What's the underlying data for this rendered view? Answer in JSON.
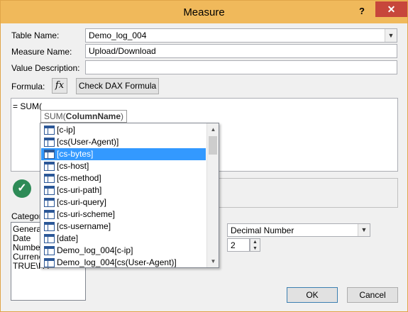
{
  "window": {
    "title": "Measure",
    "help": "?",
    "close": "✕"
  },
  "labels": {
    "table_name": "Table Name:",
    "measure_name": "Measure Name:",
    "value_description": "Value Description:",
    "formula": "Formula:",
    "category": "Categor"
  },
  "fields": {
    "table_name_value": "Demo_log_004",
    "measure_name_value": "Upload/Download",
    "value_description_value": ""
  },
  "formula": {
    "fx_label": "fx",
    "check_dax_button": "Check DAX Formula",
    "text": "= SUM(",
    "tooltip_prefix": "SUM(",
    "tooltip_param": "ColumnName",
    "tooltip_suffix": ")"
  },
  "autocomplete": {
    "selected_index": 2,
    "items": [
      "[c-ip]",
      "[cs(User-Agent)]",
      "[cs-bytes]",
      "[cs-host]",
      "[cs-method]",
      "[cs-uri-path]",
      "[cs-uri-query]",
      "[cs-uri-scheme]",
      "[cs-username]",
      "[date]",
      "Demo_log_004[c-ip]",
      "Demo_log_004[cs(User-Agent)]"
    ]
  },
  "category": {
    "options": [
      "Genera",
      "Date",
      "Numbe",
      "Currenc",
      "TRUE\\FA"
    ]
  },
  "format": {
    "type": "Decimal Number",
    "decimal_places": "2"
  },
  "buttons": {
    "ok": "OK",
    "cancel": "Cancel"
  },
  "colors": {
    "title_bar": "#f0b95b",
    "close_button": "#c7463b",
    "selection": "#3399ff",
    "check_green": "#2e8b57"
  }
}
